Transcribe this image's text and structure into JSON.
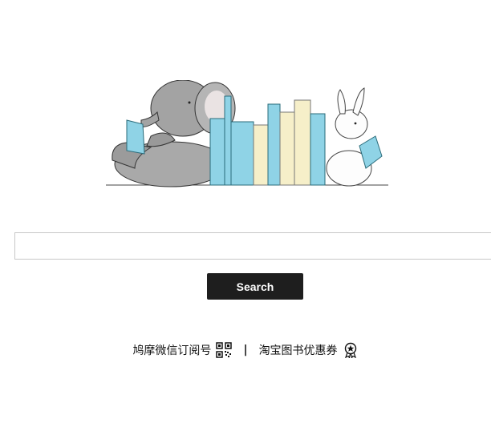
{
  "hero": {
    "illustration": "elephant-and-rabbit-reading-with-bookend-books"
  },
  "search": {
    "value": "",
    "placeholder": ""
  },
  "search_button": {
    "label": "Search"
  },
  "footer_links": {
    "wechat_label": "鸠摩微信订阅号",
    "wechat_icon": "qr-code-icon",
    "separator": "|",
    "taobao_label": "淘宝图书优惠券",
    "taobao_icon": "ribbon-badge-icon"
  },
  "colors": {
    "button_bg": "#1e1e1e",
    "button_text": "#ffffff",
    "input_border": "#c8c8c8",
    "book_blue": "#8fd3e6",
    "book_cream": "#f6efc9",
    "elephant_gray": "#9a9a9a"
  }
}
